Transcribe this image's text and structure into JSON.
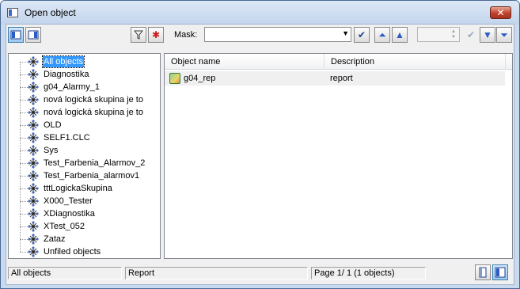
{
  "window": {
    "title": "Open object",
    "close_glyph": "✕"
  },
  "toolbar": {
    "view_tree_icon": "tree-view-icon",
    "view_list_icon": "list-view-icon",
    "filter_icon": "filter-icon",
    "clear_filter_icon": "asterisk-icon",
    "mask_label": "Mask:",
    "mask_value": "",
    "confirm_icon": "checkmark-icon",
    "nav_first_icon": "first-icon",
    "nav_prev_icon": "up-icon",
    "spin_value": "",
    "apply_icon": "checkmark-icon",
    "nav_next_icon": "down-icon",
    "nav_last_icon": "last-icon"
  },
  "tree": {
    "items": [
      {
        "label": "All objects",
        "selected": true
      },
      {
        "label": "Diagnostika"
      },
      {
        "label": "g04_Alarmy_1"
      },
      {
        "label": "nová logická skupina je to"
      },
      {
        "label": "nová logická skupina je to"
      },
      {
        "label": "OLD"
      },
      {
        "label": "SELF1.CLC"
      },
      {
        "label": "Sys"
      },
      {
        "label": "Test_Farbenia_Alarmov_2"
      },
      {
        "label": "Test_Farbenia_alarmov1"
      },
      {
        "label": "tttLogickaSkupina"
      },
      {
        "label": "X000_Tester"
      },
      {
        "label": "XDiagnostika"
      },
      {
        "label": "XTest_052"
      },
      {
        "label": "Zataz"
      },
      {
        "label": "Unfiled objects"
      }
    ]
  },
  "list": {
    "columns": [
      "Object name",
      "Description"
    ],
    "rows": [
      {
        "name": "g04_rep",
        "description": "report"
      }
    ]
  },
  "status": {
    "group": "All objects",
    "type": "Report",
    "page": "Page  1/ 1   (1 objects)"
  },
  "colors": {
    "selection": "#3399ff",
    "frame": "#c9d9ee"
  }
}
